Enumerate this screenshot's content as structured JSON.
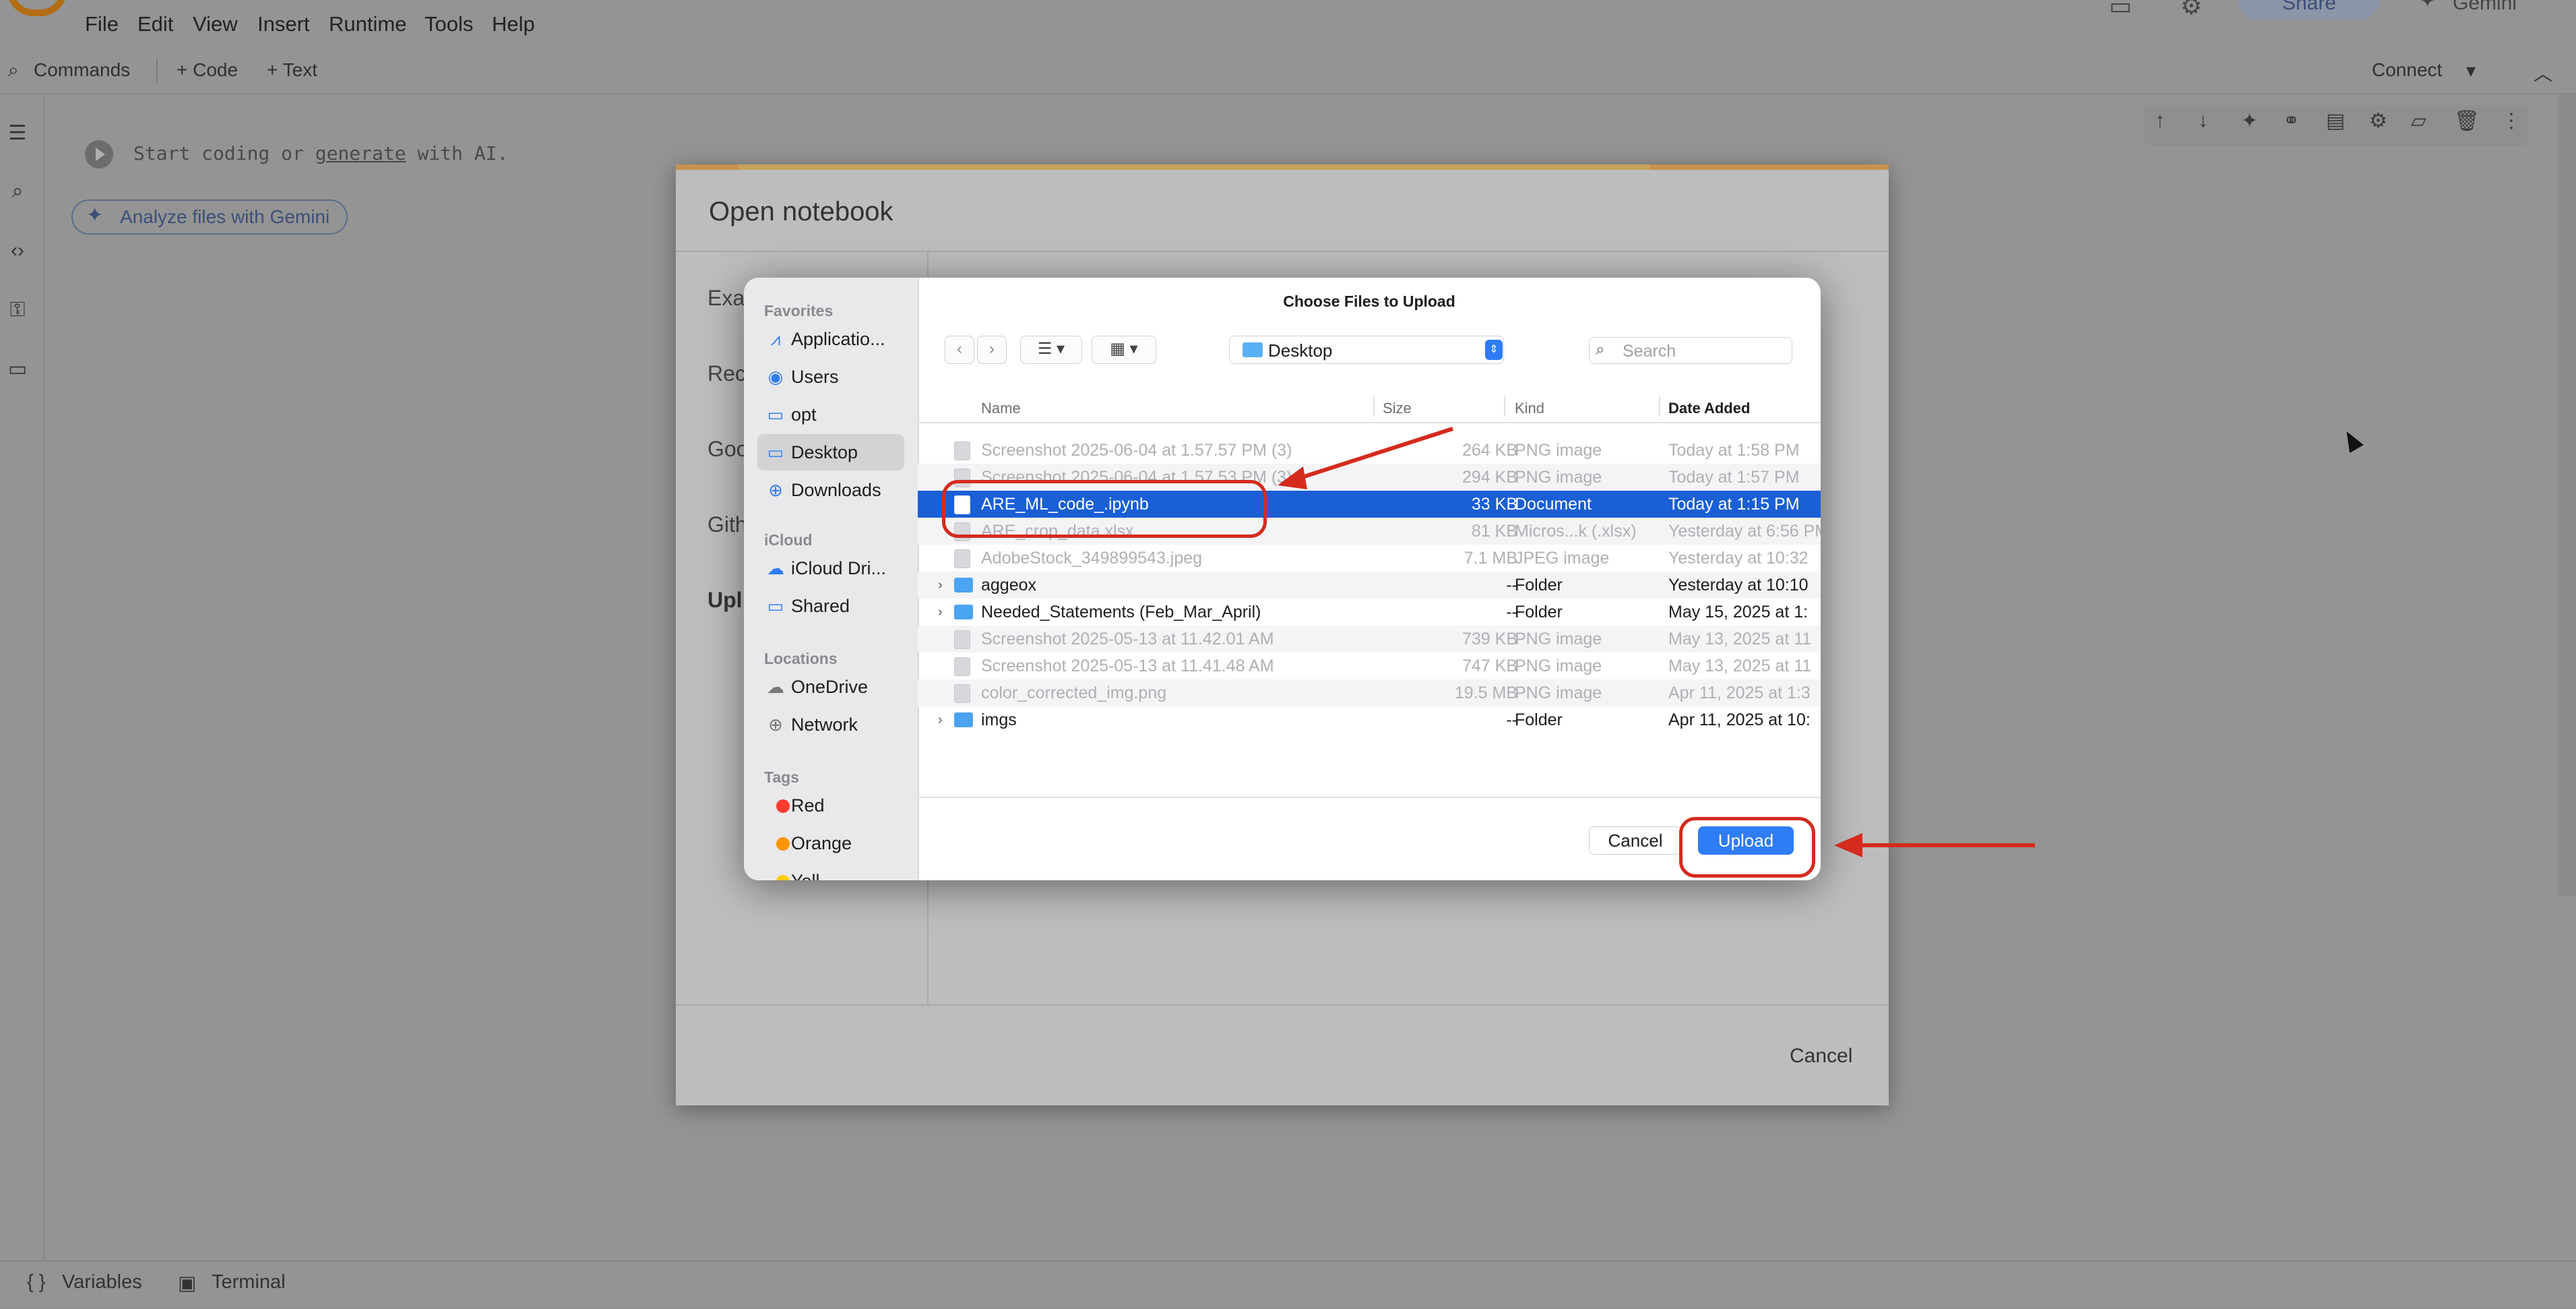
{
  "colab": {
    "menu": [
      "File",
      "Edit",
      "View",
      "Insert",
      "Runtime",
      "Tools",
      "Help"
    ],
    "header_right": {
      "share": "Share",
      "gemini": "Gemini"
    },
    "toolbar": {
      "commands": "Commands",
      "code": "+ Code",
      "text": "+ Text",
      "connect": "Connect"
    },
    "cell": {
      "hint_start": "Start coding or ",
      "hint_link": "generate",
      "hint_end": " with AI."
    },
    "analyze_button": "Analyze files with Gemini",
    "bottom": {
      "variables": "Variables",
      "terminal": "Terminal"
    }
  },
  "open_notebook": {
    "title": "Open notebook",
    "tabs": [
      "Exa",
      "Rec",
      "Goo",
      "Gith",
      "Upl"
    ],
    "cancel": "Cancel"
  },
  "file_chooser": {
    "title": "Choose Files to Upload",
    "location": "Desktop",
    "search_placeholder": "Search",
    "sidebar": {
      "favorites_label": "Favorites",
      "favorites": [
        {
          "label": "Applicatio...",
          "icon": "applications-icon"
        },
        {
          "label": "Users",
          "icon": "user-icon"
        },
        {
          "label": "opt",
          "icon": "folder-icon"
        },
        {
          "label": "Desktop",
          "icon": "desktop-icon"
        },
        {
          "label": "Downloads",
          "icon": "downloads-icon"
        }
      ],
      "icloud_label": "iCloud",
      "icloud": [
        {
          "label": "iCloud Dri...",
          "icon": "cloud-icon"
        },
        {
          "label": "Shared",
          "icon": "shared-folder-icon"
        }
      ],
      "locations_label": "Locations",
      "locations": [
        {
          "label": "OneDrive",
          "icon": "cloud-icon"
        },
        {
          "label": "Network",
          "icon": "globe-icon"
        }
      ],
      "tags_label": "Tags",
      "tags": [
        {
          "label": "Red",
          "color": "#ff3b30"
        },
        {
          "label": "Orange",
          "color": "#ff9500"
        },
        {
          "label": "Yell",
          "color": "#ffcc00"
        }
      ]
    },
    "columns": {
      "name": "Name",
      "size": "Size",
      "kind": "Kind",
      "date": "Date Added"
    },
    "rows": [
      {
        "name": "Screenshot 2025-06-04 at 1.57.57 PM (3)",
        "size": "264 KB",
        "kind": "PNG image",
        "date": "Today at 1:58 PM",
        "state": "dim",
        "type": "image"
      },
      {
        "name": "Screenshot 2025-06-04 at 1.57.53 PM (3)",
        "size": "294 KB",
        "kind": "PNG image",
        "date": "Today at 1:57 PM",
        "state": "dim",
        "type": "image"
      },
      {
        "name": "ARE_ML_code_.ipynb",
        "size": "33 KB",
        "kind": "Document",
        "date": "Today at 1:15 PM",
        "state": "selected",
        "type": "doc"
      },
      {
        "name": "ARE_crop_data.xlsx",
        "size": "81 KB",
        "kind": "Micros...k (.xlsx)",
        "date": "Yesterday at 6:56 PM",
        "state": "dim",
        "type": "sheet"
      },
      {
        "name": "AdobeStock_349899543.jpeg",
        "size": "7.1 MB",
        "kind": "JPEG image",
        "date": "Yesterday at 10:32",
        "state": "dim",
        "type": "image"
      },
      {
        "name": "aggeox",
        "size": "--",
        "kind": "Folder",
        "date": "Yesterday at 10:10",
        "state": "normal",
        "type": "folder"
      },
      {
        "name": "Needed_Statements (Feb_Mar_April)",
        "size": "--",
        "kind": "Folder",
        "date": "May 15, 2025 at 1:",
        "state": "normal",
        "type": "folder"
      },
      {
        "name": "Screenshot 2025-05-13 at 11.42.01 AM",
        "size": "739 KB",
        "kind": "PNG image",
        "date": "May 13, 2025 at 11",
        "state": "dim",
        "type": "image"
      },
      {
        "name": "Screenshot 2025-05-13 at 11.41.48 AM",
        "size": "747 KB",
        "kind": "PNG image",
        "date": "May 13, 2025 at 11",
        "state": "dim",
        "type": "image"
      },
      {
        "name": "color_corrected_img.png",
        "size": "19.5 MB",
        "kind": "PNG image",
        "date": "Apr 11, 2025 at 1:3",
        "state": "dim",
        "type": "image"
      },
      {
        "name": "imgs",
        "size": "--",
        "kind": "Folder",
        "date": "Apr 11, 2025 at 10:",
        "state": "normal",
        "type": "folder"
      }
    ],
    "cancel": "Cancel",
    "upload": "Upload"
  },
  "colors": {
    "accent": "#2e7cf6",
    "selection": "#1a5fd6",
    "annotation": "#d42b1e"
  }
}
